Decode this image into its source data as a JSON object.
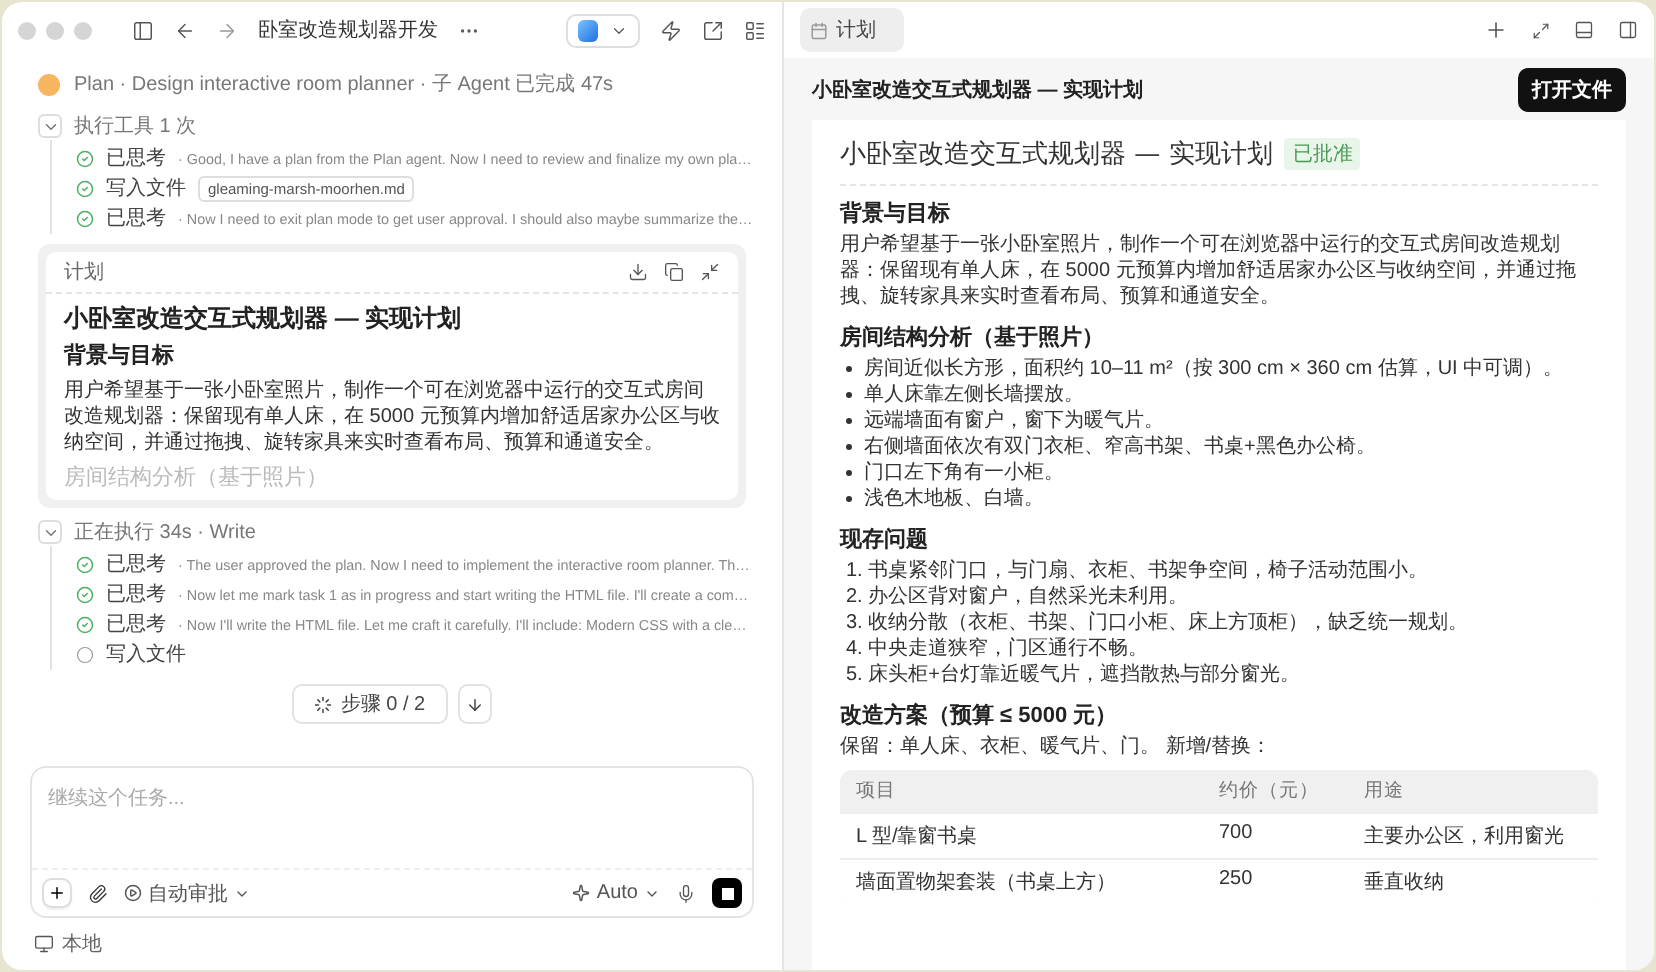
{
  "titlebar": {
    "title": "卧室改造规划器开发"
  },
  "agent": {
    "text": "Plan · Design interactive room planner · 子 Agent 已完成 47s"
  },
  "thread": [
    {
      "kind": "group",
      "label": "执行工具 1 次",
      "expanded": true,
      "steps": [
        {
          "kind": "thought",
          "done": true,
          "label": "已思考",
          "detail": "· Good, I have a plan from the Plan agent. Now I need to review and finalize my own pla…"
        },
        {
          "kind": "file",
          "done": true,
          "label": "写入文件",
          "file": "gleaming-marsh-moorhen.md"
        },
        {
          "kind": "thought",
          "done": true,
          "label": "已思考",
          "detail": "· Now I need to exit plan mode to get user approval. I should also maybe summarize the…"
        }
      ]
    },
    {
      "kind": "plan",
      "label": "计划",
      "title": "小卧室改造交互式规划器 — 实现计划",
      "heading": "背景与目标",
      "text": "用户希望基于一张小卧室照片，制作一个可在浏览器中运行的交互式房间改造规划器：保留现有单人床，在 5000 元预算内增加舒适居家办公区与收纳空间，并通过拖拽、旋转家具来实时查看布局、预算和通道安全。",
      "faded": "房间结构分析（基于照片）"
    },
    {
      "kind": "group",
      "label": "正在执行 34s · Write",
      "expanded": true,
      "steps": [
        {
          "kind": "thought",
          "done": true,
          "label": "已思考",
          "detail": "· The user approved the plan. Now I need to implement the interactive room planner. Th…"
        },
        {
          "kind": "thought",
          "done": true,
          "label": "已思考",
          "detail": "· Now let me mark task 1 as in progress and start writing the HTML file. I'll create a com…"
        },
        {
          "kind": "thought",
          "done": true,
          "label": "已思考",
          "detail": "· Now I'll write the HTML file. Let me craft it carefully. I'll include: Modern CSS with a cle…"
        },
        {
          "kind": "file",
          "done": false,
          "label": "写入文件"
        }
      ]
    }
  ],
  "progress": {
    "text": "步骤 0 / 2"
  },
  "composer": {
    "placeholder": "继续这个任务...",
    "mode": "自动审批",
    "model": "Auto"
  },
  "footer": {
    "location": "本地"
  },
  "panel_tab": {
    "label": "计划",
    "selected": true
  },
  "panel_header": {
    "title": "小卧室改造交互式规划器 — 实现计划",
    "button": "打开文件"
  },
  "document": {
    "title": "小卧室改造交互式规划器 — 实现计划",
    "badge": "已批准",
    "sections": [
      {
        "heading": "背景与目标",
        "paragraph": "用户希望基于一张小卧室照片，制作一个可在浏览器中运行的交互式房间改造规划器：保留现有单人床，在 5000 元预算内增加舒适居家办公区与收纳空间，并通过拖拽、旋转家具来实时查看布局、预算和通道安全。"
      },
      {
        "heading": "房间结构分析（基于照片）",
        "bullets": [
          "房间近似长方形，面积约 10–11 m²（按 300 cm × 360 cm 估算，UI 中可调）。",
          "单人床靠左侧长墙摆放。",
          "远端墙面有窗户，窗下为暖气片。",
          "右侧墙面依次有双门衣柜、窄高书架、书桌+黑色办公椅。",
          "门口左下角有一小柜。",
          "浅色木地板、白墙。"
        ]
      },
      {
        "heading": "现存问题",
        "numbered": [
          "1. 书桌紧邻门口，与门扇、衣柜、书架争空间，椅子活动范围小。",
          "2. 办公区背对窗户，自然采光未利用。",
          "3. 收纳分散（衣柜、书架、门口小柜、床上方顶柜），缺乏统一规划。",
          "4. 中央走道狭窄，门区通行不畅。",
          "5. 床头柜+台灯靠近暖气片，遮挡散热与部分窗光。"
        ]
      },
      {
        "heading": "改造方案（预算 ≤ 5000 元）",
        "paragraph": "保留：单人床、衣柜、暖气片、门。 新增/替换：",
        "table": {
          "columns": [
            "项目",
            "约价（元）",
            "用途"
          ],
          "rows": [
            [
              "L 型/靠窗书桌",
              "700",
              "主要办公区，利用窗光"
            ],
            [
              "墙面置物架套装（书桌上方）",
              "250",
              "垂直收纳"
            ]
          ]
        }
      }
    ]
  }
}
